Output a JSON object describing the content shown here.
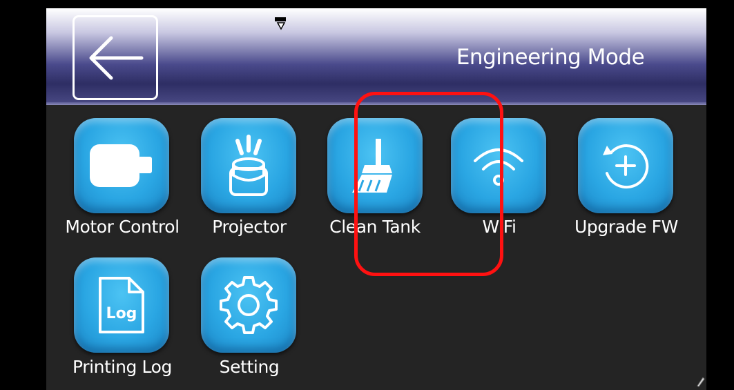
{
  "header": {
    "title": "Engineering Mode",
    "back_icon": "arrow-left-icon"
  },
  "menu": {
    "items": [
      {
        "label": "Motor Control",
        "icon": "motor-icon"
      },
      {
        "label": "Projector",
        "icon": "projector-icon"
      },
      {
        "label": "Clean Tank",
        "icon": "broom-icon",
        "highlighted": true
      },
      {
        "label": "WiFi",
        "icon": "wifi-icon"
      },
      {
        "label": "Upgrade FW",
        "icon": "upgrade-icon"
      },
      {
        "label": "Printing Log",
        "icon": "log-file-icon"
      },
      {
        "label": "Setting",
        "icon": "gear-icon"
      }
    ]
  },
  "colors": {
    "tile": "#2aa6e3",
    "highlight": "#ff1111",
    "background": "#242424"
  }
}
